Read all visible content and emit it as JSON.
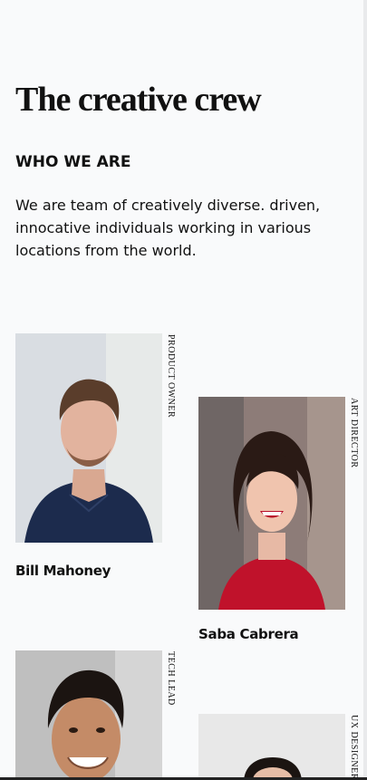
{
  "page": {
    "title": "The creative crew",
    "subtitle": "WHO WE ARE",
    "intro": "We are team of creatively diverse. driven, innocative individuals working in various locations from the world."
  },
  "team": [
    {
      "name": "Bill Mahoney",
      "role": "PRODUCT OWNER",
      "photo_icon": "man-portrait"
    },
    {
      "name": "Saba Cabrera",
      "role": "ART DIRECTOR",
      "photo_icon": "woman-portrait"
    },
    {
      "name": "",
      "role": "TECH LEAD",
      "photo_icon": "man-portrait"
    },
    {
      "name": "",
      "role": "UX DESIGNER",
      "photo_icon": "woman-portrait"
    }
  ]
}
